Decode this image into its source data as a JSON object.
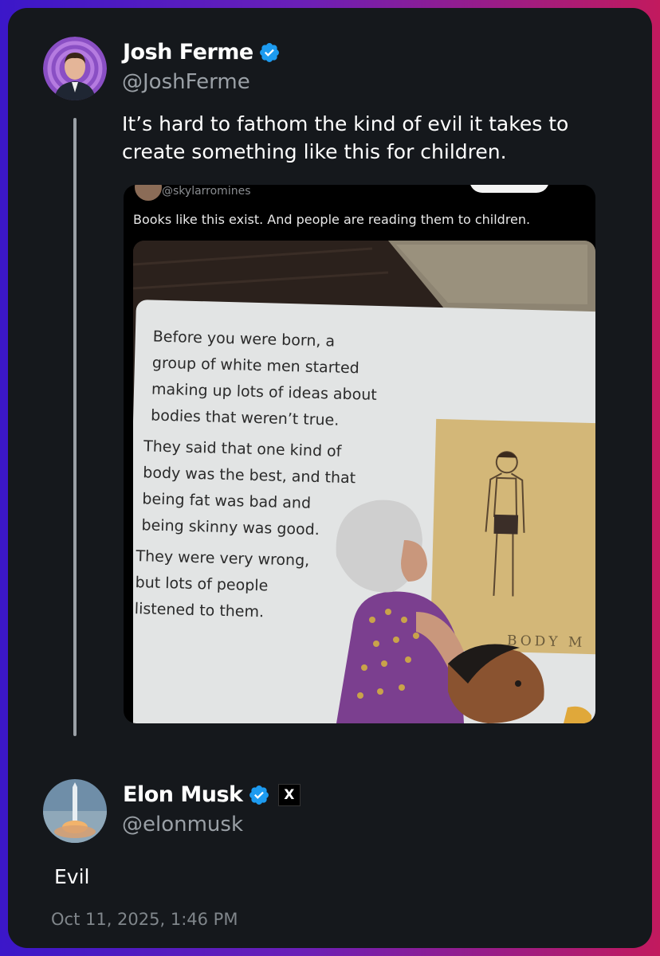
{
  "parent_tweet": {
    "author_name": "Josh Ferme",
    "author_handle": "@JoshFerme",
    "verified": true,
    "text": "It’s hard to fathom the kind of evil it takes to create something like this for children.",
    "avatar_icon": "person-avatar-icon",
    "embedded_media": {
      "quoted_handle": "@skylarromines",
      "quoted_caption": "Books like this exist. And people are reading them to children.",
      "book_paragraphs": [
        "Before you were born, a\ngroup of white men started\nmaking up lots of ideas about\nbodies that weren’t true.",
        "They said that one kind of\nbody was the best, and that\nbeing fat was bad and\nbeing skinny was good.",
        "They were very wrong,\nbut lots of people\nlistened to them."
      ],
      "illustration_label": "BODY M"
    }
  },
  "reply_tweet": {
    "author_name": "Elon Musk",
    "author_handle": "@elonmusk",
    "verified": true,
    "affiliate_badge": "X",
    "text": "Evil",
    "timestamp": "Oct 11, 2025, 1:46 PM",
    "avatar_icon": "rocket-launch-avatar-icon"
  },
  "colors": {
    "card_background": "#15181c",
    "verified_blue": "#1d9bf0",
    "muted_text": "#9aa0a6"
  }
}
